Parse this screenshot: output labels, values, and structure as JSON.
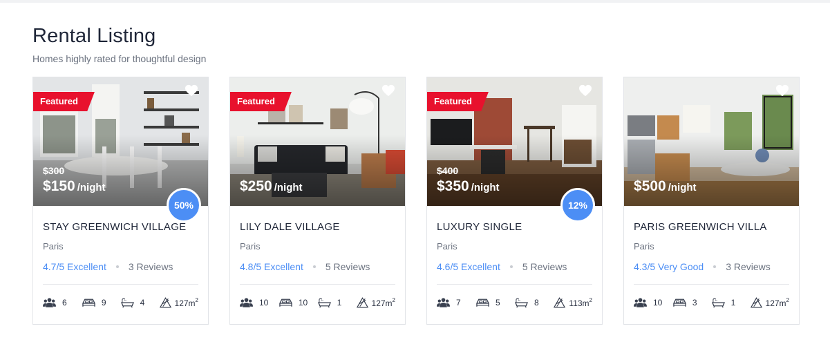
{
  "section": {
    "title": "Rental Listing",
    "subtitle": "Homes highly rated for thoughtful design"
  },
  "listings": [
    {
      "title": "STAY GREENWICH VILLAGE",
      "city": "Paris",
      "featured_label": "Featured",
      "old_price": "$300",
      "price": "$150",
      "price_unit": "/night",
      "discount": "50%",
      "rating": "4.7/5 Excellent",
      "reviews": "3 Reviews",
      "guests": "6",
      "beds": "9",
      "baths": "4",
      "area": "127m",
      "area_unit_sup": "2"
    },
    {
      "title": "LILY DALE VILLAGE",
      "city": "Paris",
      "featured_label": "Featured",
      "old_price": "",
      "price": "$250",
      "price_unit": "/night",
      "discount": "",
      "rating": "4.8/5 Excellent",
      "reviews": "5 Reviews",
      "guests": "10",
      "beds": "10",
      "baths": "1",
      "area": "127m",
      "area_unit_sup": "2"
    },
    {
      "title": "LUXURY SINGLE",
      "city": "Paris",
      "featured_label": "Featured",
      "old_price": "$400",
      "price": "$350",
      "price_unit": "/night",
      "discount": "12%",
      "rating": "4.6/5 Excellent",
      "reviews": "5 Reviews",
      "guests": "7",
      "beds": "5",
      "baths": "8",
      "area": "113m",
      "area_unit_sup": "2"
    },
    {
      "title": "PARIS GREENWICH VILLA",
      "city": "Paris",
      "featured_label": "",
      "old_price": "",
      "price": "$500",
      "price_unit": "/night",
      "discount": "",
      "rating": "4.3/5 Very Good",
      "reviews": "3 Reviews",
      "guests": "10",
      "beds": "3",
      "baths": "1",
      "area": "127m",
      "area_unit_sup": "2"
    }
  ],
  "colors": {
    "featured_badge": "#e8112d",
    "discount_badge": "#4c8ef5",
    "rating_text": "#4c8ef5",
    "title_text": "#1f2638"
  },
  "icons": {
    "favorite": "heart-icon",
    "guests": "users-icon",
    "beds": "bed-icon",
    "baths": "bathtub-icon",
    "area": "area-icon"
  }
}
